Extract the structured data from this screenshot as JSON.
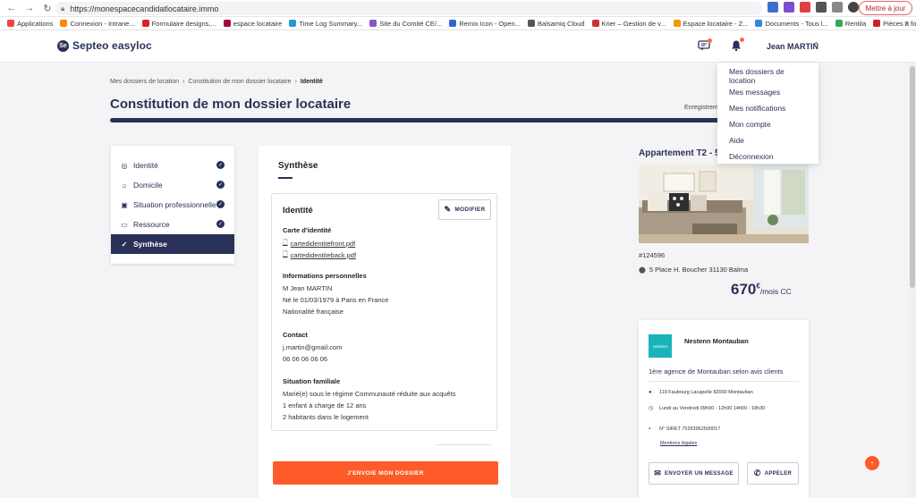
{
  "browser": {
    "url": "https://monespacecandidatlocataire.immo",
    "update_label": "Mettre à jour",
    "bookmarks": [
      {
        "label": "Applications",
        "color": "#e44"
      },
      {
        "label": "Connexion - Intrane...",
        "color": "#f80"
      },
      {
        "label": "Formulaire designs,...",
        "color": "#d22"
      },
      {
        "label": "espace locataire",
        "color": "#a04"
      },
      {
        "label": "Time Log Summary...",
        "color": "#29c"
      },
      {
        "label": "Site du Comité CE/...",
        "color": "#85c"
      },
      {
        "label": "Remix Icon - Open...",
        "color": "#36c"
      },
      {
        "label": "Balsamiq Cloud",
        "color": "#555"
      },
      {
        "label": "Krier – Gestion de v...",
        "color": "#c33"
      },
      {
        "label": "Espace locataire - Z...",
        "color": "#e90"
      },
      {
        "label": "Documents - Tous l...",
        "color": "#38d"
      },
      {
        "label": "Rentila",
        "color": "#3a5"
      },
      {
        "label": "Pièces à fournir po...",
        "color": "#c22"
      }
    ],
    "more": "»"
  },
  "header": {
    "logo_mark": "Se",
    "logo_text": "Septeo easyloc",
    "user_name": "Jean MARTIN"
  },
  "user_menu": [
    "Mes dossiers de location",
    "Mes messages",
    "Mes notifications",
    "Mon compte",
    "Aide",
    "Déconnexion"
  ],
  "breadcrumb": {
    "items": [
      "Mes dossiers de location",
      "Constitution de mon dossier locataire"
    ],
    "current": "Identité",
    "sep": "›"
  },
  "page": {
    "title": "Constitution de mon dossier locataire",
    "saved": "Enregistremer",
    "progress_fraction": 1.0
  },
  "steps": [
    {
      "label": "Identité",
      "icon": "user-circle-icon",
      "done": true
    },
    {
      "label": "Domicile",
      "icon": "home-icon",
      "done": true
    },
    {
      "label": "Situation professionnelle",
      "icon": "briefcase-icon",
      "done": true
    },
    {
      "label": "Ressource",
      "icon": "wallet-icon",
      "done": true
    },
    {
      "label": "Synthèse",
      "icon": "check-icon",
      "done": false,
      "active": true
    }
  ],
  "synthese": {
    "title": "Synthèse",
    "card": {
      "title": "Identité",
      "modify_label": "MODIFIER",
      "id_card_label": "Carte d'identité",
      "files": [
        "cartedidentitefront.pdf",
        "cartedidentiteback.pdf"
      ],
      "personal_label": "Informations personnelles",
      "personal": [
        "M Jean MARTIN",
        "Né le 01/03/1979 à Paris en France",
        "Nationalité française"
      ],
      "contact_label": "Contact",
      "contact": [
        "j.martin@gmail.com",
        "06 06 06 06 06"
      ],
      "family_label": "Situation familiale",
      "family": [
        "Marié(e) sous le régime Communauté réduite aux acquêts",
        "1 enfant à charge de 12 ans",
        "2 habitants dans le logement"
      ]
    },
    "send_label": "J'ENVOIE MON DOSSIER"
  },
  "property": {
    "title": "Appartement T2 - 5",
    "ref": "#124596",
    "address": "5 Place H. Boucher 31130 Balma",
    "price": "670",
    "currency": "€",
    "price_unit": "/mois CC"
  },
  "agency": {
    "logo_text": "nestenn",
    "name": "Nestenn Montauban",
    "tagline": "1ère agence de Montauban selon avis clients",
    "address": "119 Faubourg Lacapelle 82000 Montauban",
    "hours": "Lundi au Vendredi 09h00 - 12h00 14h00 - 18h30",
    "siret": "N° SIRET 75263962500017",
    "legal": "Mentions légales",
    "message_label": "ENVOYER UN MESSAGE",
    "call_label": "APPELER"
  },
  "colors": {
    "primary": "#2a3158",
    "accent": "#ff5a2a",
    "agency": "#17b5ba"
  }
}
